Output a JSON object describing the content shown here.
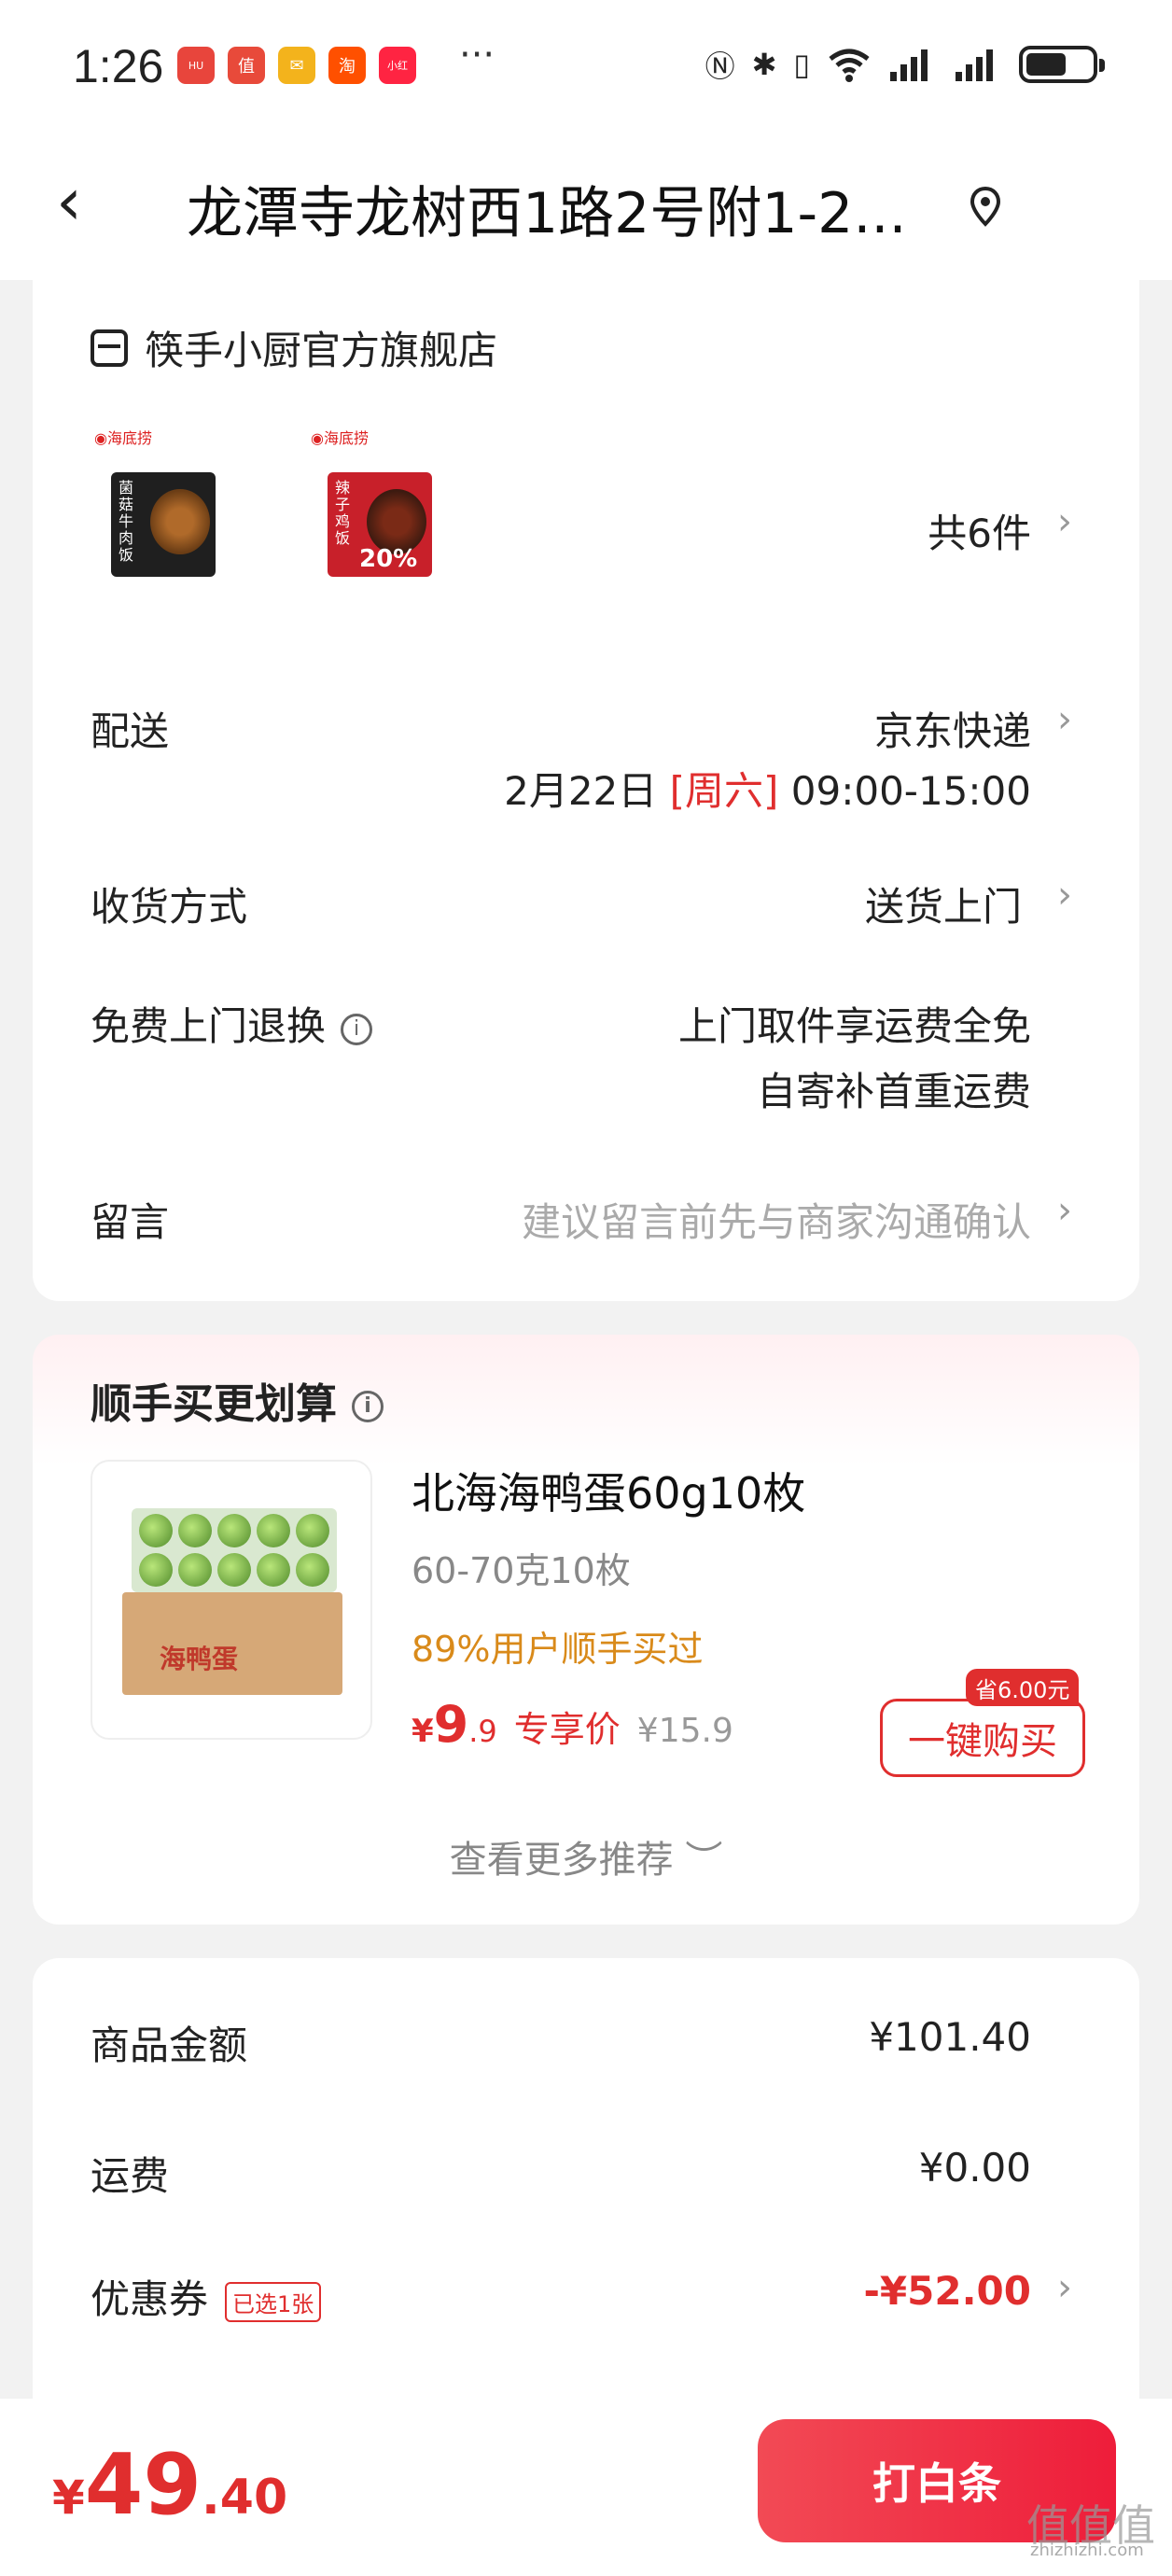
{
  "status_bar": {
    "time": "1:26",
    "apps": [
      {
        "name": "huawei-app-icon",
        "label": "HUAWEI",
        "color": "#e8453c"
      },
      {
        "name": "zhi-app-icon",
        "label": "值",
        "color": "#e84a3a"
      },
      {
        "name": "mail-app-icon",
        "label": "✉",
        "color": "#f3b31c"
      },
      {
        "name": "taobao-app-icon",
        "label": "淘",
        "color": "#ff5000"
      },
      {
        "name": "xiaohongshu-app-icon",
        "label": "小红书",
        "color": "#ff2442"
      }
    ],
    "more": "···"
  },
  "nav": {
    "title": "龙潭寺龙树西1路2号附1-2..."
  },
  "order": {
    "shop_name": "筷手小厨官方旗舰店",
    "items_count": "共6件",
    "thumb1_text": "菌菇牛肉饭",
    "thumb2_text": "辣子鸡饭",
    "thumb2_badge": "20%",
    "delivery_label": "配送",
    "delivery_courier": "京东快递",
    "delivery_date": "2月22日",
    "delivery_weekday": "[周六]",
    "delivery_time": "09:00-15:00",
    "receive_label": "收货方式",
    "receive_value": "送货上门",
    "return_label": "免费上门退换",
    "return_line1": "上门取件享运费全免",
    "return_line2": "自寄补首重运费",
    "message_label": "留言",
    "message_placeholder": "建议留言前先与商家沟通确认"
  },
  "recommend": {
    "title": "顺手买更划算",
    "product_name": "北海海鸭蛋60g10枚",
    "spec": "60-70克10枚",
    "bought": "89%用户顺手买过",
    "price_symbol": "¥",
    "price_int": "9",
    "price_dec": ".9",
    "price_tag": "专享价",
    "original_price": "¥15.9",
    "save_badge": "省6.00元",
    "buy_button": "一键购买",
    "box_label": "海鸭蛋",
    "more": "查看更多推荐 ︶"
  },
  "summary": {
    "goods_label": "商品金额",
    "goods_value": "¥101.40",
    "shipping_label": "运费",
    "shipping_value": "¥0.00",
    "coupon_label": "优惠券",
    "coupon_tag": "已选1张",
    "coupon_value": "-¥52.00"
  },
  "bottom": {
    "total_symbol": "¥",
    "total_int": "49",
    "total_dec": ".40",
    "pay_button": "打白条"
  },
  "watermark": {
    "main": "值值值",
    "sub": "zhizhizhi.com"
  }
}
